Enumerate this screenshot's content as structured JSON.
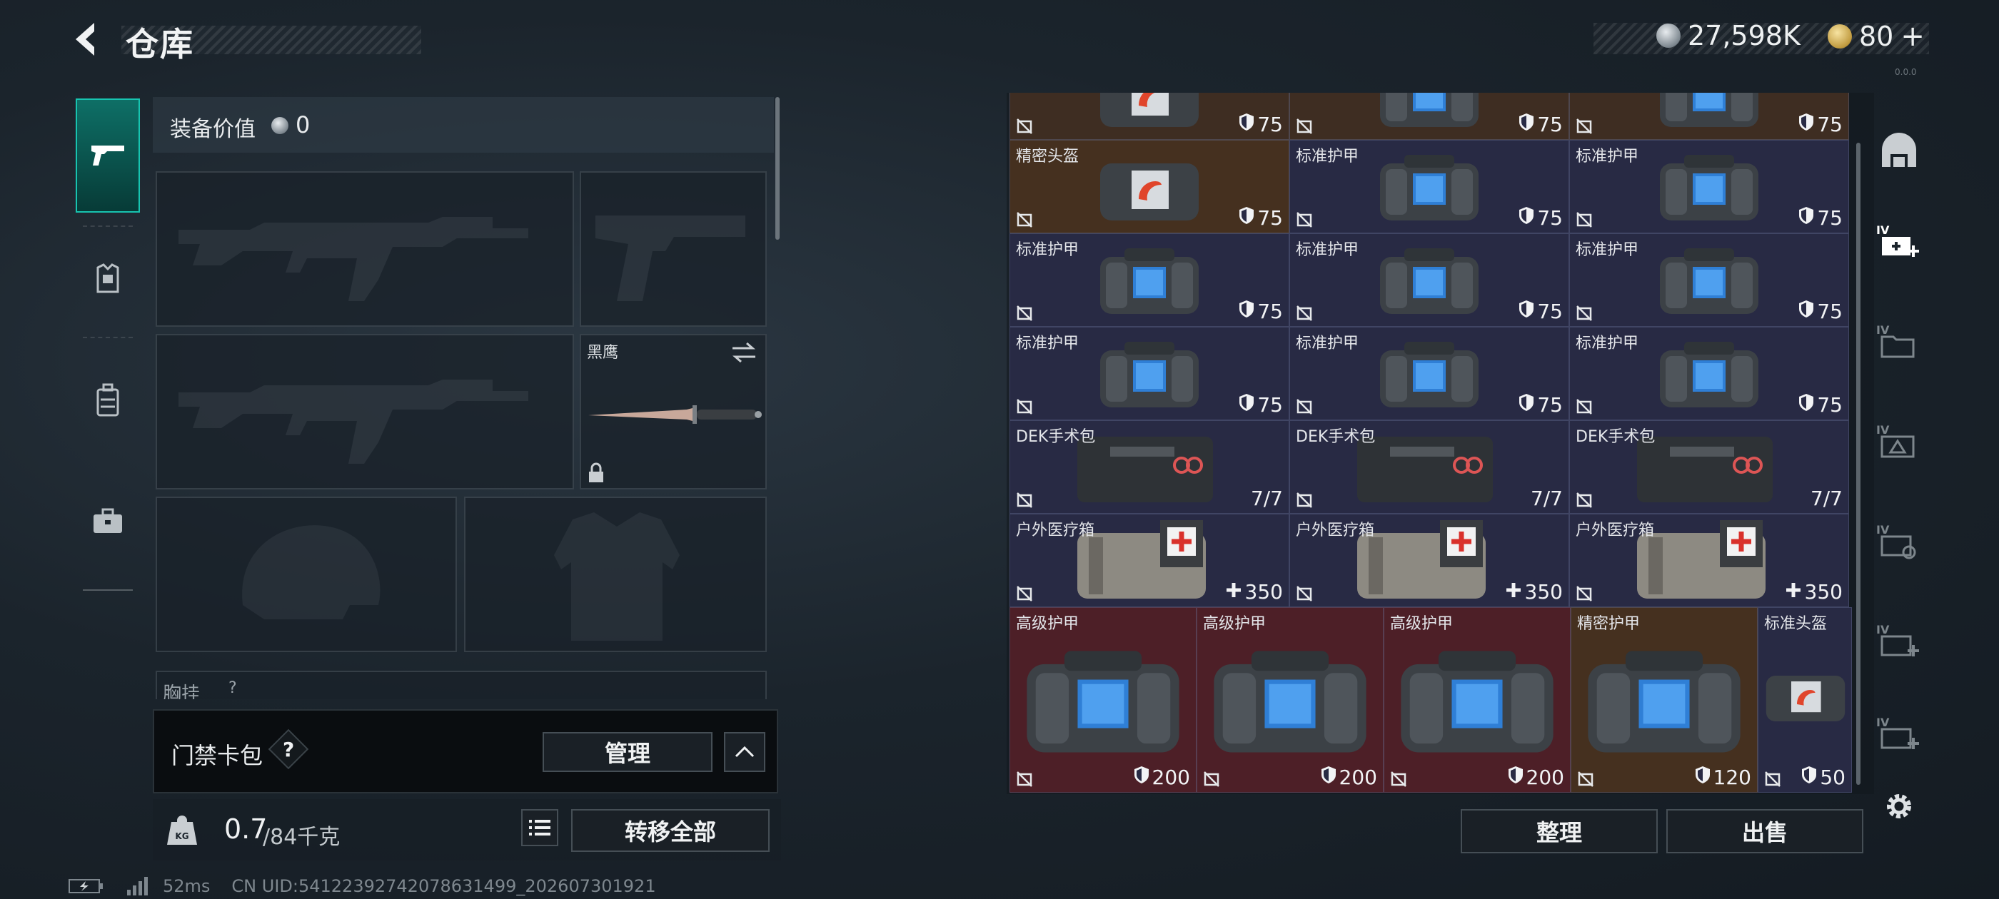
{
  "header": {
    "title": "仓库",
    "currency": [
      {
        "icon": "silver-coin-icon",
        "value": "27,598K"
      },
      {
        "icon": "gold-coin-icon",
        "value": "80"
      }
    ],
    "version_tag": "0.0.0"
  },
  "side_nav": [
    {
      "icon": "pistol-icon",
      "active": true
    },
    {
      "icon": "armor-plate-icon",
      "active": false
    },
    {
      "icon": "backpack-icon",
      "active": false
    },
    {
      "icon": "toolbox-icon",
      "active": false
    }
  ],
  "loadout": {
    "equip_value_label": "装备价值",
    "equip_value": "0",
    "melee_name": "黑鹰",
    "chest_rig_label": "胸挂",
    "chest_rig_hint": "?",
    "access_card_label": "门禁卡包",
    "access_card_help": "?",
    "manage_button": "管理",
    "weight_current": "0.7",
    "weight_max": "/84千克",
    "transfer_all_button": "转移全部"
  },
  "inventory": {
    "rows": [
      [
        {
          "name": "",
          "value": "75",
          "type": "shield"
        },
        {
          "name": "",
          "value": "75",
          "type": "shield"
        },
        {
          "name": "",
          "value": "75",
          "type": "shield"
        }
      ],
      [
        {
          "name": "精密头盔",
          "value": "75",
          "type": "shield"
        },
        {
          "name": "标准护甲",
          "value": "75",
          "type": "shield"
        },
        {
          "name": "标准护甲",
          "value": "75",
          "type": "shield"
        }
      ],
      [
        {
          "name": "标准护甲",
          "value": "75",
          "type": "shield"
        },
        {
          "name": "标准护甲",
          "value": "75",
          "type": "shield"
        },
        {
          "name": "标准护甲",
          "value": "75",
          "type": "shield"
        }
      ],
      [
        {
          "name": "标准护甲",
          "value": "75",
          "type": "shield"
        },
        {
          "name": "标准护甲",
          "value": "75",
          "type": "shield"
        },
        {
          "name": "标准护甲",
          "value": "75",
          "type": "shield"
        }
      ],
      [
        {
          "name": "DEK手术包",
          "value": "7/7",
          "type": "count"
        },
        {
          "name": "DEK手术包",
          "value": "7/7",
          "type": "count"
        },
        {
          "name": "DEK手术包",
          "value": "7/7",
          "type": "count"
        }
      ],
      [
        {
          "name": "户外医疗箱",
          "value": "350",
          "type": "heal"
        },
        {
          "name": "户外医疗箱",
          "value": "350",
          "type": "heal"
        },
        {
          "name": "户外医疗箱",
          "value": "350",
          "type": "heal"
        }
      ]
    ],
    "bottom_row": [
      {
        "name": "高级护甲",
        "value": "200"
      },
      {
        "name": "高级护甲",
        "value": "200"
      },
      {
        "name": "高级护甲",
        "value": "200"
      },
      {
        "name": "精密护甲",
        "value": "120"
      },
      {
        "name": "标准头盔",
        "value": "50"
      }
    ],
    "sort_button": "整理",
    "sell_button": "出售"
  },
  "right_tabs": [
    "helmet-tab-icon",
    "tier4-add-case-icon",
    "tier4-folder-icon",
    "tier4-warning-case-icon",
    "tier4-tag-case-icon",
    "tier4-add-case-icon-2",
    "tier4-add-case-icon-3",
    "settings-gear-icon"
  ],
  "status_bar": {
    "ping": "52ms",
    "uid": "CN UID:54122392742078631499_202607301921"
  },
  "colors": {
    "accent_teal": "#17c4b0",
    "brown_cell": "#4a3526",
    "red_cell": "#4d1f27",
    "blue_cell": "#282a44"
  }
}
